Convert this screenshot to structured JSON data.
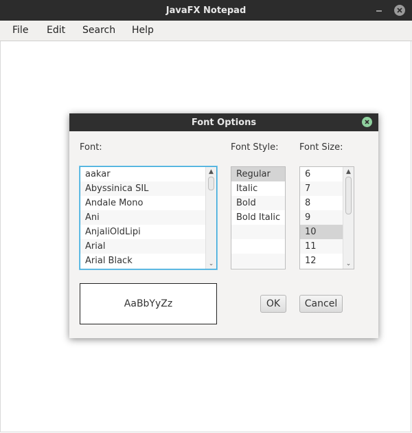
{
  "window": {
    "title": "JavaFX Notepad"
  },
  "menubar": {
    "items": [
      "File",
      "Edit",
      "Search",
      "Help"
    ]
  },
  "dialog": {
    "title": "Font Options",
    "font_label": "Font:",
    "style_label": "Font Style:",
    "size_label": "Font Size:",
    "fonts": [
      "aakar",
      "Abyssinica SIL",
      "Andale Mono",
      "Ani",
      "AnjaliOldLipi",
      "Arial",
      "Arial Black"
    ],
    "styles": [
      "Regular",
      "Italic",
      "Bold",
      "Bold Italic"
    ],
    "sizes": [
      "6",
      "7",
      "8",
      "9",
      "10",
      "11",
      "12"
    ],
    "selected_style": "Regular",
    "selected_size": "10",
    "preview_text": "AaBbYyZz",
    "ok_label": "OK",
    "cancel_label": "Cancel"
  },
  "icons": {
    "minimize": "minimize-icon",
    "close": "close-icon",
    "dialog_close": "close-icon",
    "scroll_up": "chevron-up-icon",
    "scroll_down": "chevron-down-icon"
  },
  "colors": {
    "titlebar": "#2c2c2c",
    "focus_border": "#3aa7d9",
    "dialog_close": "#8fd19e",
    "selection": "#d4d4d4"
  }
}
